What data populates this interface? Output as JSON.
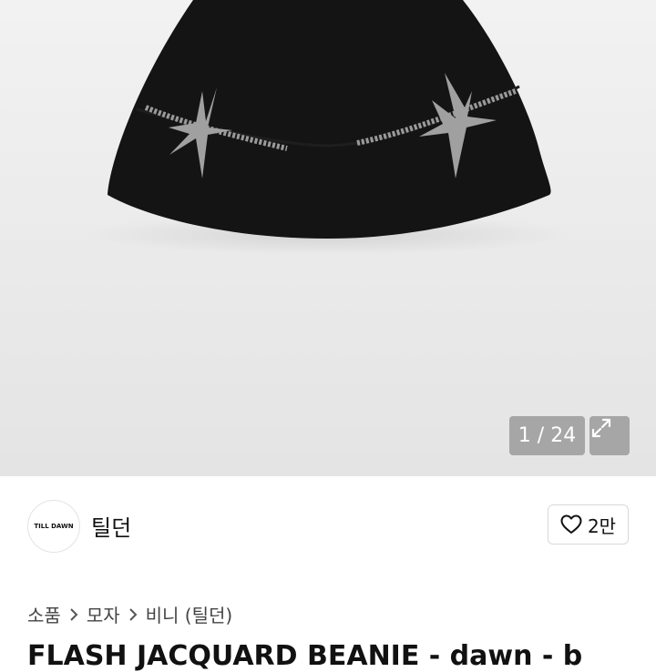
{
  "gallery": {
    "counter": "1 / 24"
  },
  "shop": {
    "logo_text": "TILL DAWN",
    "name": "틸던",
    "likes": "2만"
  },
  "breadcrumb": [
    "소품",
    "모자",
    "비니 (틸던)"
  ],
  "product": {
    "title": "FLASH JACQUARD BEANIE - dawn - b"
  },
  "colors": {
    "counter_bg": "#a6a6a6",
    "beanie": "#141414",
    "jacquard": "#9a9a9a"
  },
  "icons": {
    "expand": "expand-icon",
    "heart": "heart-icon",
    "chevron": "chevron-right-icon"
  }
}
